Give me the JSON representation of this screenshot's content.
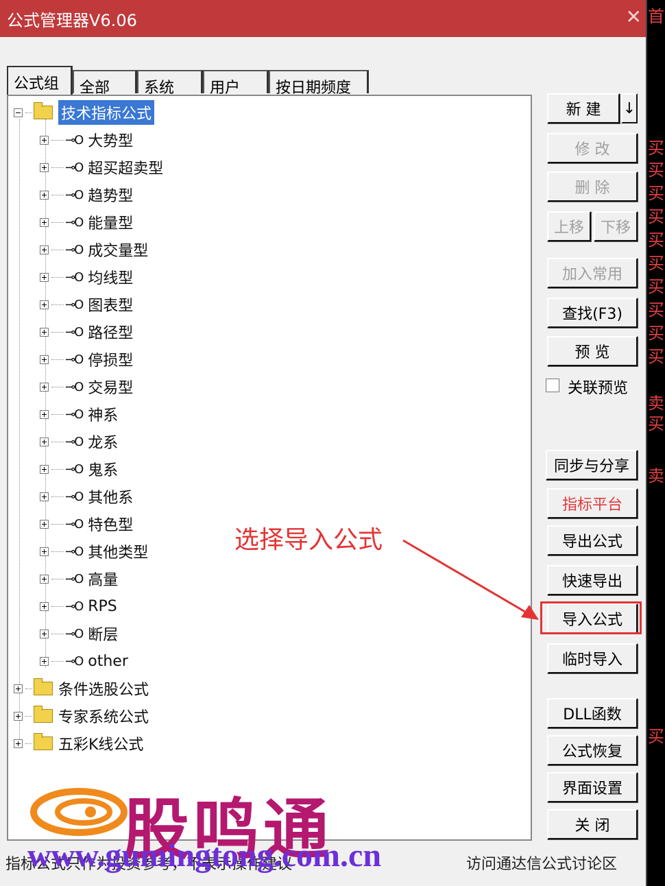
{
  "window": {
    "title": "公式管理器V6.06",
    "close_label": "✕"
  },
  "tabs": [
    "公式组",
    "全部",
    "系统",
    "用户",
    "按日期频度"
  ],
  "tree": {
    "root": "技术指标公式",
    "children": [
      "大势型",
      "超买超卖型",
      "趋势型",
      "能量型",
      "成交量型",
      "均线型",
      "图表型",
      "路径型",
      "停损型",
      "交易型",
      "神系",
      "龙系",
      "鬼系",
      "其他系",
      "特色型",
      "其他类型",
      "高量",
      "RPS",
      "断层",
      "other"
    ],
    "other_roots": [
      "条件选股公式",
      "专家系统公式",
      "五彩K线公式"
    ]
  },
  "buttons": {
    "new": "新 建",
    "new_arrow": "↓",
    "modify": "修 改",
    "delete": "删 除",
    "move_up": "上移",
    "move_down": "下移",
    "add_common": "加入常用",
    "find": "查找(F3)",
    "preview": "预 览",
    "linked_preview": "关联预览",
    "sync_share": "同步与分享",
    "indicator_platform": "指标平台",
    "export": "导出公式",
    "quick_export": "快速导出",
    "import": "导入公式",
    "temp_import": "临时导入",
    "dll": "DLL函数",
    "restore": "公式恢复",
    "ui_settings": "界面设置",
    "close": "关 闭"
  },
  "annotation": "选择导入公式",
  "footer": {
    "left": "指标公式只作为投资参考，不表示操作建议",
    "right": "访问通达信公式讨论区"
  },
  "watermark": {
    "name": "股鸣通",
    "url": "www.gumingtong.com.cn"
  },
  "side_chars": [
    "首",
    "买",
    "买",
    "买",
    "买",
    "买",
    "买",
    "买",
    "买",
    "买",
    "买",
    "卖",
    "买",
    "卖",
    "买"
  ],
  "colors": {
    "titlebar": "#c0393b",
    "highlight": "#e23434",
    "selection": "#3a78d4"
  }
}
